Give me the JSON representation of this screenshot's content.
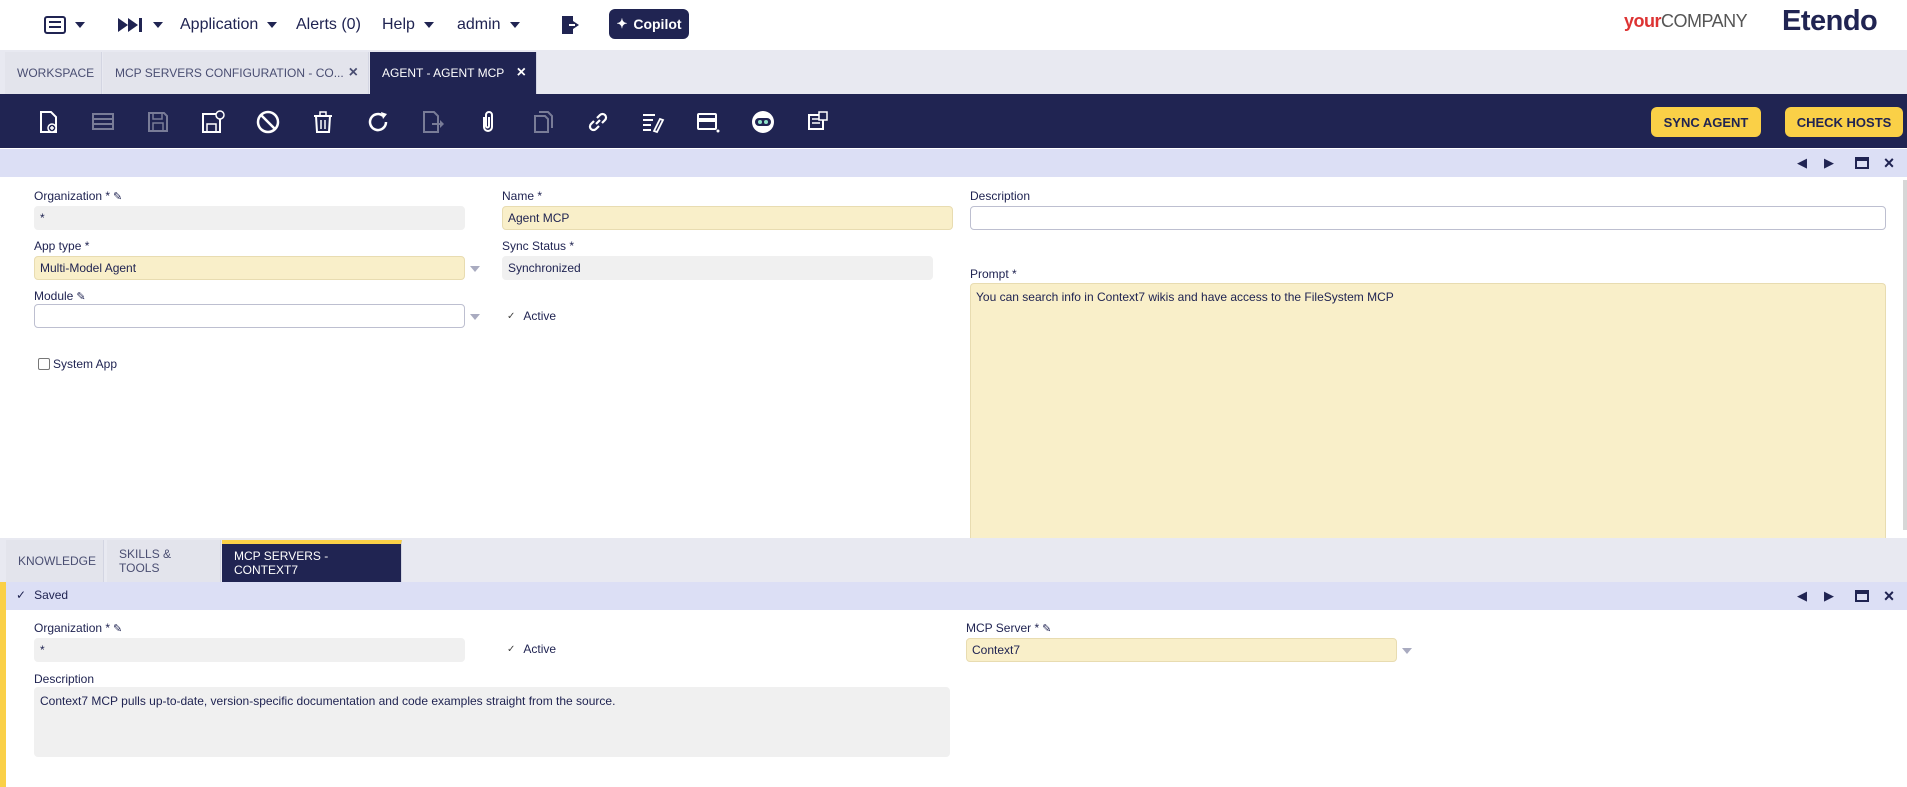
{
  "nav": {
    "application": "Application",
    "alerts": "Alerts (0)",
    "help": "Help",
    "user": "admin",
    "copilot": "Copilot",
    "brand_your": "your",
    "brand_company": "COMPANY",
    "brand_etendo": "Etendo"
  },
  "window_tabs": [
    {
      "label": "WORKSPACE"
    },
    {
      "label": "MCP SERVERS CONFIGURATION - CO..."
    },
    {
      "label": "AGENT - AGENT MCP"
    }
  ],
  "toolbar": {
    "icons": [
      "new-document-icon",
      "new-row-icon",
      "save-icon",
      "save-close-icon",
      "undo-icon",
      "delete-icon",
      "refresh-icon",
      "export-icon",
      "attachment-icon",
      "clone-icon",
      "link-icon",
      "audit-icon",
      "grid-view-icon",
      "copilot-bot-icon",
      "print-icon"
    ],
    "sync_agent": "SYNC AGENT",
    "check_hosts": "CHECK HOSTS"
  },
  "form": {
    "organization_label": "Organization *",
    "organization_value": "*",
    "name_label": "Name *",
    "name_value": "Agent MCP",
    "description_label": "Description",
    "description_value": "",
    "app_type_label": "App type *",
    "app_type_value": "Multi-Model Agent",
    "sync_status_label": "Sync Status *",
    "sync_status_value": "Synchronized",
    "prompt_label": "Prompt *",
    "prompt_value": "You can search info in Context7 wikis and have access to the FileSystem MCP",
    "module_label": "Module",
    "module_value": "",
    "active_label": "Active",
    "system_app_label": "System App"
  },
  "sub_tabs": [
    {
      "label": "KNOWLEDGE"
    },
    {
      "label": "SKILLS & TOOLS"
    },
    {
      "label": "MCP SERVERS - CONTEXT7"
    }
  ],
  "subform": {
    "status": "Saved",
    "organization_label": "Organization *",
    "organization_value": "*",
    "active_label": "Active",
    "mcp_server_label": "MCP Server *",
    "mcp_server_value": "Context7",
    "description_label": "Description",
    "description_value": "Context7 MCP pulls up-to-date, version-specific documentation and code examples straight from the source."
  },
  "colors": {
    "navy": "#202452",
    "accent_yellow": "#fad047",
    "required_field": "#f9efc9",
    "section_bar": "#dcdff5"
  }
}
